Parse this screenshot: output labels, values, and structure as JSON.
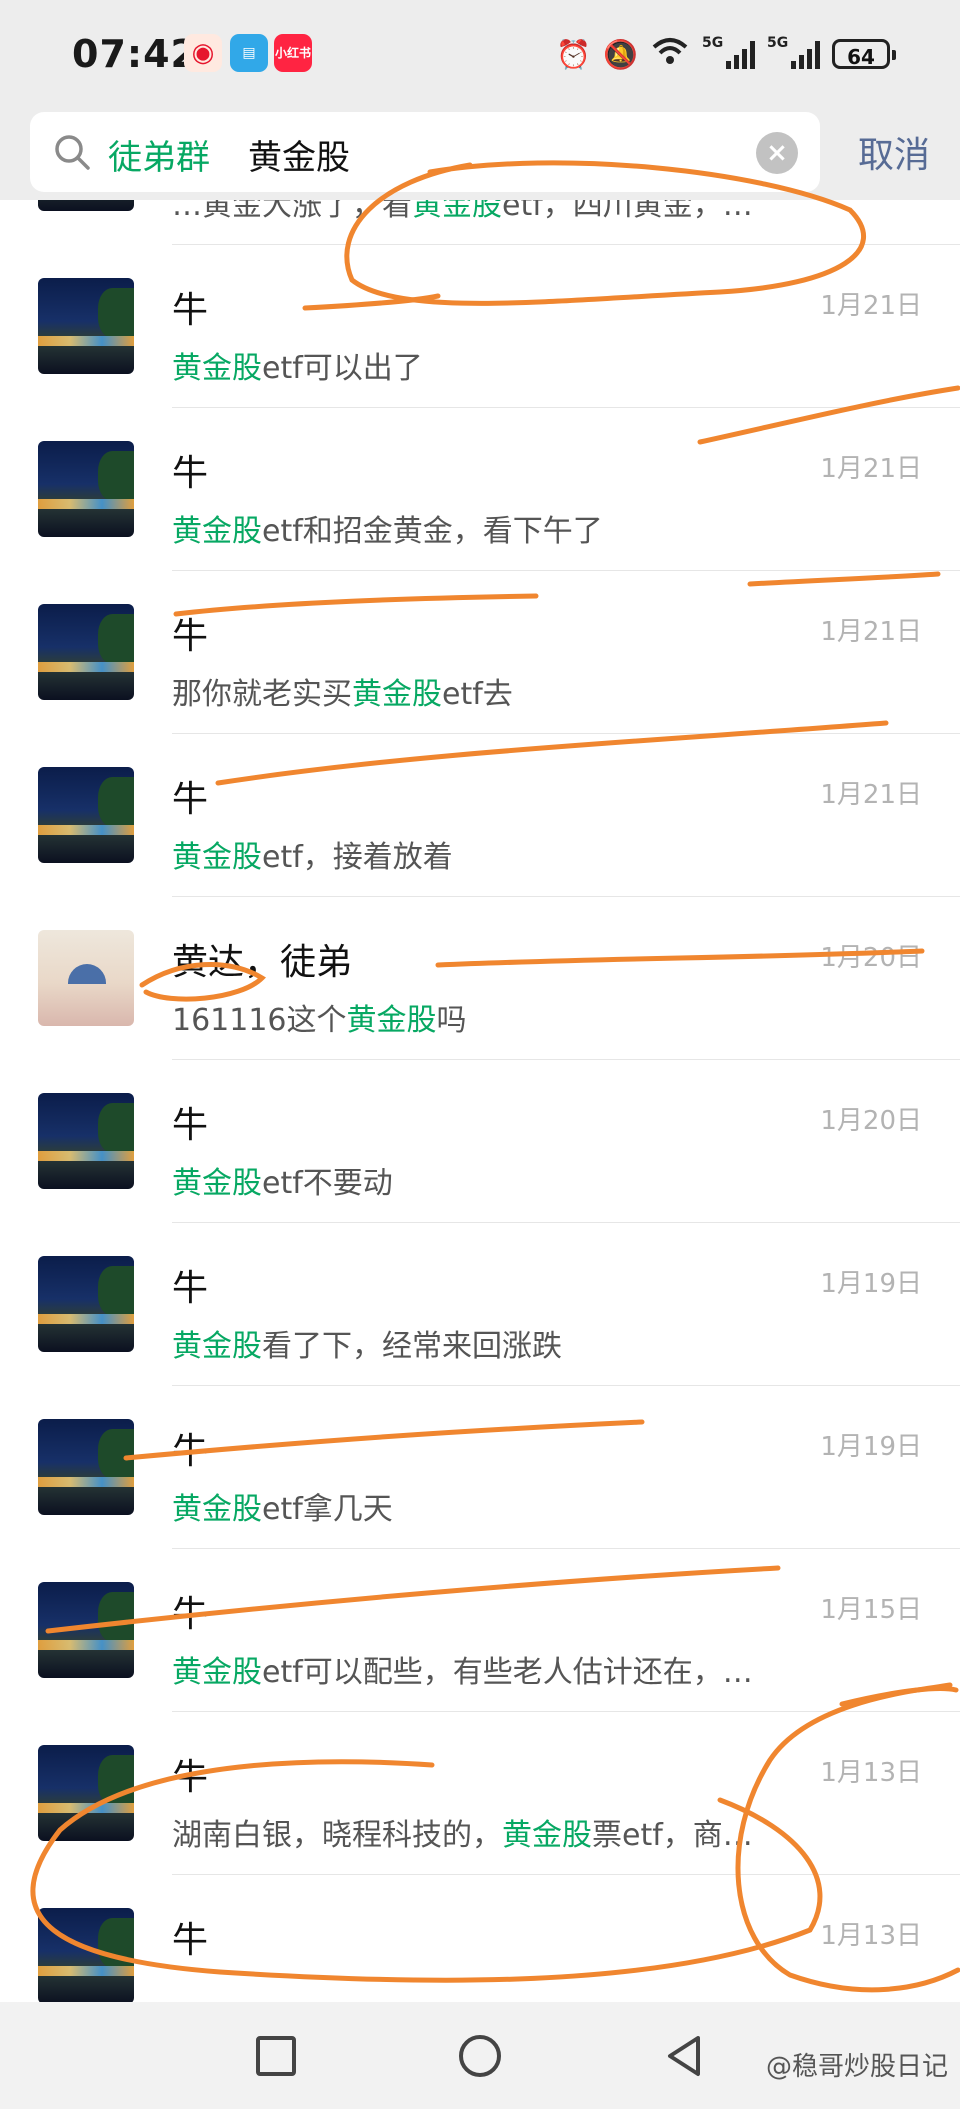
{
  "status_bar": {
    "time": "07:42",
    "app_icons": [
      "weibo-icon",
      "book-icon",
      "xiaohongshu-icon"
    ],
    "app_icon_labels": {
      "xiaohongshu": "小红书"
    },
    "signal1_label": "5G",
    "signal2_label": "5G",
    "wifi_label": "6",
    "battery": "64"
  },
  "search": {
    "tag": "徒弟群",
    "term": "黄金股",
    "cancel_label": "取消"
  },
  "results": [
    {
      "name": "",
      "date": "",
      "msg_pre": "…黄金大涨了，看",
      "msg_hl": "黄金股",
      "msg_post": "etf，四川黄金，…"
    },
    {
      "name": "牛",
      "date": "1月21日",
      "msg_pre": "",
      "msg_hl": "黄金股",
      "msg_post": "etf可以出了"
    },
    {
      "name": "牛",
      "date": "1月21日",
      "msg_pre": "",
      "msg_hl": "黄金股",
      "msg_post": "etf和招金黄金，看下午了"
    },
    {
      "name": "牛",
      "date": "1月21日",
      "msg_pre": "那你就老实买",
      "msg_hl": "黄金股",
      "msg_post": "etf去"
    },
    {
      "name": "牛",
      "date": "1月21日",
      "msg_pre": "",
      "msg_hl": "黄金股",
      "msg_post": "etf，接着放着"
    },
    {
      "name": "黄达，徒弟",
      "date": "1月20日",
      "msg_pre": "161116这个",
      "msg_hl": "黄金股",
      "msg_post": "吗"
    },
    {
      "name": "牛",
      "date": "1月20日",
      "msg_pre": "",
      "msg_hl": "黄金股",
      "msg_post": "etf不要动"
    },
    {
      "name": "牛",
      "date": "1月19日",
      "msg_pre": "",
      "msg_hl": "黄金股",
      "msg_post": "看了下，经常来回涨跌"
    },
    {
      "name": "牛",
      "date": "1月19日",
      "msg_pre": "",
      "msg_hl": "黄金股",
      "msg_post": "etf拿几天"
    },
    {
      "name": "牛",
      "date": "1月15日",
      "msg_pre": "",
      "msg_hl": "黄金股",
      "msg_post": "etf可以配些，有些老人估计还在，…"
    },
    {
      "name": "牛",
      "date": "1月13日",
      "msg_pre": "湖南白银，晓程科技的，",
      "msg_hl": "黄金股",
      "msg_post": "票etf，商…"
    },
    {
      "name": "牛",
      "date": "1月13日",
      "msg_pre": "",
      "msg_hl": "",
      "msg_post": ""
    }
  ],
  "watermark": "@稳哥炒股日记",
  "colors": {
    "highlight": "#07a863",
    "cancel": "#576b95",
    "annotation": "#f0862f"
  }
}
